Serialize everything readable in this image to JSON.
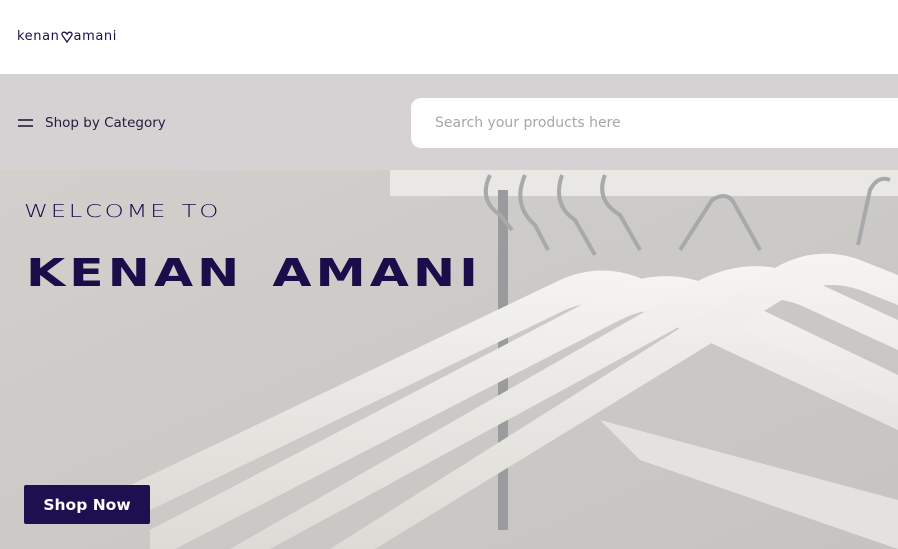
{
  "header": {
    "logo_text_left": "kenan",
    "logo_text_right": "amani",
    "logo_icon": "heart-icon"
  },
  "nav": {
    "category_label": "Shop by Category",
    "category_icon": "menu-icon",
    "search_placeholder": "Search your products here",
    "search_value": ""
  },
  "hero": {
    "welcome": "welcome to",
    "brand": "kenan amani",
    "cta_label": "Shop Now"
  },
  "colors": {
    "brand": "#1b0d49",
    "nav_bg": "#d5d2d3",
    "button_bg": "#1e1050",
    "button_text": "#ffffff"
  }
}
